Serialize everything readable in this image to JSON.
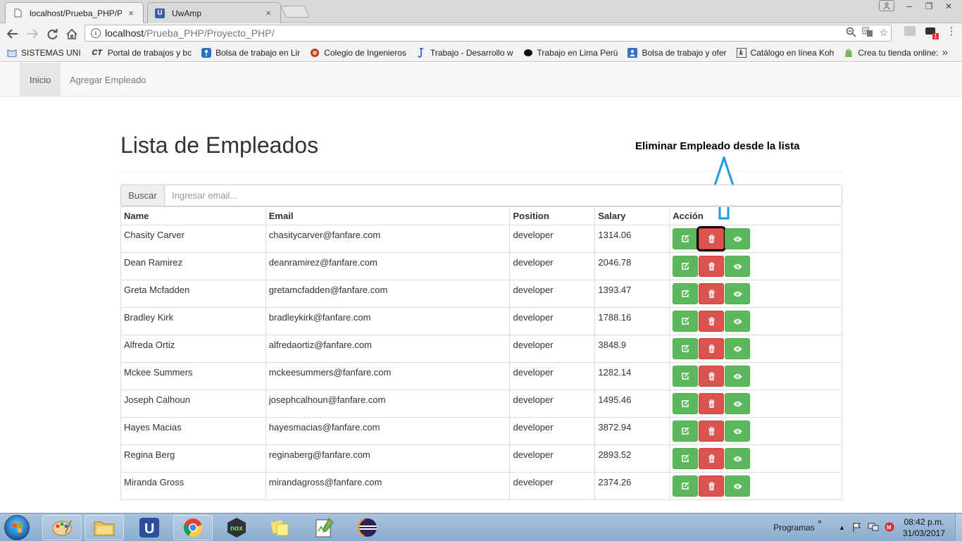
{
  "browser": {
    "tabs": [
      {
        "title": "localhost/Prueba_PHP/P",
        "active": true,
        "close": "×"
      },
      {
        "title": "UwAmp",
        "active": false,
        "close": "×"
      }
    ],
    "address": {
      "host": "localhost",
      "path": "/Prueba_PHP/Proyecto_PHP/"
    },
    "bookmarks": [
      {
        "label": "SISTEMAS UNI",
        "icon": "book-icon"
      },
      {
        "label": "Portal de trabajos y bc",
        "icon": "ct-logo-icon",
        "mark": "CT"
      },
      {
        "label": "Bolsa de trabajo en Lir",
        "icon": "pin-icon"
      },
      {
        "label": "Colegio de Ingenieros",
        "icon": "ring-icon"
      },
      {
        "label": "Trabajo - Desarrollo w",
        "icon": "hook-icon"
      },
      {
        "label": "Trabajo en Lima Perú",
        "icon": "blob-icon"
      },
      {
        "label": "Bolsa de trabajo y ofer",
        "icon": "person-icon"
      },
      {
        "label": "Catálogo en línea Koh",
        "icon": "koha-icon",
        "mark": "k"
      },
      {
        "label": "Crea tu tienda online:",
        "icon": "shopify-icon"
      }
    ],
    "more": "»"
  },
  "nav": {
    "items": [
      "Inicio",
      "Agregar Empleado"
    ],
    "active": 0
  },
  "page": {
    "title": "Lista de Empleados",
    "annotation": "Eliminar Empleado desde la lista"
  },
  "search": {
    "label": "Buscar",
    "placeholder": "Ingresar email..."
  },
  "table": {
    "headers": [
      "Name",
      "Email",
      "Position",
      "Salary",
      "Acción"
    ],
    "rows": [
      [
        "Chasity Carver",
        "chasitycarver@fanfare.com",
        "developer",
        "1314.06"
      ],
      [
        "Dean Ramirez",
        "deanramirez@fanfare.com",
        "developer",
        "2046.78"
      ],
      [
        "Greta Mcfadden",
        "gretamcfadden@fanfare.com",
        "developer",
        "1393.47"
      ],
      [
        "Bradley Kirk",
        "bradleykirk@fanfare.com",
        "developer",
        "1788.16"
      ],
      [
        "Alfreda Ortiz",
        "alfredaortiz@fanfare.com",
        "developer",
        "3848.9"
      ],
      [
        "Mckee Summers",
        "mckeesummers@fanfare.com",
        "developer",
        "1282.14"
      ],
      [
        "Joseph Calhoun",
        "josephcalhoun@fanfare.com",
        "developer",
        "1495.46"
      ],
      [
        "Hayes Macias",
        "hayesmacias@fanfare.com",
        "developer",
        "3872.94"
      ],
      [
        "Regina Berg",
        "reginaberg@fanfare.com",
        "developer",
        "2893.52"
      ],
      [
        "Miranda Gross",
        "mirandagross@fanfare.com",
        "developer",
        "2374.26"
      ]
    ],
    "actions": [
      "edit-icon",
      "trash-icon",
      "eye-icon"
    ],
    "highlighted_delete_row": 0
  },
  "taskbar": {
    "apps": [
      "paint-icon",
      "explorer-icon",
      "uwamp-icon",
      "chrome-icon",
      "nox-icon",
      "sticky-notes-icon",
      "notepad-plus-icon",
      "eclipse-icon"
    ],
    "tray_label": "Programas",
    "time": "08:42 p.m.",
    "date": "31/03/2017"
  },
  "colors": {
    "success": "#5cb85c",
    "danger": "#d9534f",
    "arrow": "#1a9be0"
  }
}
